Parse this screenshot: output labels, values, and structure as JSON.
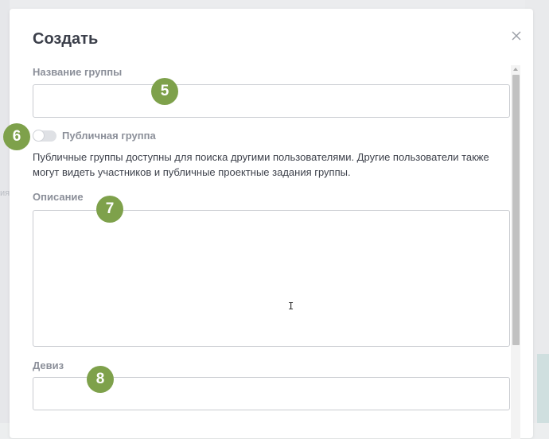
{
  "background": {
    "peek_left": "ия"
  },
  "dialog": {
    "title": "Создать",
    "close_icon": "close-icon",
    "fields": {
      "group_name": {
        "label": "Название группы",
        "value": "",
        "placeholder": ""
      },
      "public_toggle": {
        "label": "Публичная группа",
        "checked": false,
        "help": "Публичные группы доступны для поиска другими пользователями. Другие пользователи также могут видеть участников и публичные проектные задания группы."
      },
      "description": {
        "label": "Описание",
        "value": "",
        "placeholder": ""
      },
      "motto": {
        "label": "Девиз",
        "value": "",
        "placeholder": ""
      }
    }
  },
  "badges": {
    "b5": "5",
    "b6": "6",
    "b7": "7",
    "b8": "8"
  },
  "colors": {
    "badge": "#7ea14b",
    "label": "#8b8f99",
    "text": "#3e424c",
    "border": "#c9cbd0"
  }
}
